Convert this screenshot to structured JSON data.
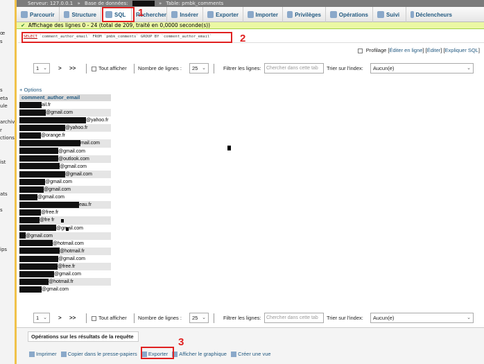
{
  "sidebar_fragments": [
    "œ",
    "s",
    "s",
    "eta",
    "ule",
    "archive",
    "r",
    "ctions",
    "ist",
    "ats",
    "s",
    "ips"
  ],
  "breadcrumb": {
    "server": "Serveur: 127.0.0.1",
    "database": "Base de données:",
    "table": "Table: pmbk_comments"
  },
  "tabs": [
    {
      "label": "Parcourir",
      "icon": "browse-icon"
    },
    {
      "label": "Structure",
      "icon": "structure-icon"
    },
    {
      "label": "SQL",
      "icon": "sql-icon"
    },
    {
      "label": "Rechercher",
      "icon": "search-icon"
    },
    {
      "label": "Insérer",
      "icon": "insert-icon"
    },
    {
      "label": "Exporter",
      "icon": "export-icon"
    },
    {
      "label": "Importer",
      "icon": "import-icon"
    },
    {
      "label": "Privilèges",
      "icon": "privileges-icon"
    },
    {
      "label": "Opérations",
      "icon": "operations-icon"
    },
    {
      "label": "Suivi",
      "icon": "tracking-icon"
    },
    {
      "label": "Déclencheurs",
      "icon": "triggers-icon"
    }
  ],
  "annotations": {
    "step1": "1",
    "step2": "2",
    "step3": "3"
  },
  "success_message": "Affichage des lignes 0 - 24 (total de 209, traité en 0,0000 seconde(s))",
  "sql_query": {
    "select_kw": "SELECT",
    "rest": "`comment_author_email` FROM `pmbk_comments` GROUP BY `comment_author_email`"
  },
  "profiling": {
    "label": "Profilage",
    "edit_inline": "Éditer en ligne",
    "edit": "Éditer",
    "explain": "Expliquer SQL"
  },
  "pagination": {
    "page": "1",
    "next": ">",
    "last": ">>",
    "show_all": "Tout afficher",
    "rows_label": "Nombre de lignes :",
    "rows_value": "25",
    "filter_label": "Filtrer les lignes:",
    "filter_placeholder": "Chercher dans cette tab",
    "sort_label": "Trier sur l'index:",
    "sort_value": "Aucun(e)"
  },
  "options_link": "+ Options",
  "column_header": "comment_author_email",
  "emails": [
    {
      "redact": 32,
      "suffix": "ail.fr"
    },
    {
      "redact": 38,
      "suffix": "@gmail.com"
    },
    {
      "redact": 96,
      "suffix": "@yahoo.fr"
    },
    {
      "redact": 66,
      "suffix": "@yahoo.fr"
    },
    {
      "redact": 31,
      "suffix": "@orange.fr"
    },
    {
      "redact": 88,
      "suffix": "mail.com"
    },
    {
      "redact": 56,
      "suffix": "@gmail.com"
    },
    {
      "redact": 56,
      "suffix": "@outlook.com"
    },
    {
      "redact": 58,
      "suffix": "@gmail.com"
    },
    {
      "redact": 66,
      "suffix": "@gmail.com"
    },
    {
      "redact": 37,
      "suffix": "@gmail.com"
    },
    {
      "redact": 35,
      "suffix": "@gmail.com"
    },
    {
      "redact": 26,
      "suffix": "@gmail.com"
    },
    {
      "redact": 86,
      "suffix": "eau.fr"
    },
    {
      "redact": 31,
      "suffix": "@free.fr"
    },
    {
      "redact": 29,
      "suffix": "@fre fr"
    },
    {
      "redact": 53,
      "suffix": "@gmail.com"
    },
    {
      "redact": 9,
      "suffix": "@gmail.com"
    },
    {
      "redact": 48,
      "suffix": "@hotmail.com"
    },
    {
      "redact": 58,
      "suffix": "@hotmail.fr"
    },
    {
      "redact": 56,
      "suffix": "@gmail.com"
    },
    {
      "redact": 55,
      "suffix": "@free.fr"
    },
    {
      "redact": 50,
      "suffix": "@gmail.com"
    },
    {
      "redact": 42,
      "suffix": "@hotmail.fr"
    },
    {
      "redact": 32,
      "suffix": "@gmail.com"
    }
  ],
  "operations": {
    "title": "Opérations sur les résultats de la requête",
    "print": "Imprimer",
    "copy": "Copier dans le presse-papiers",
    "export": "Exporter",
    "chart": "Afficher le graphique",
    "view": "Créer une vue"
  },
  "colors": {
    "accent_link": "#235a81",
    "highlight": "#e02020",
    "success_bg": "#ebf8a4",
    "sidebar_border": "#f0c24a"
  }
}
